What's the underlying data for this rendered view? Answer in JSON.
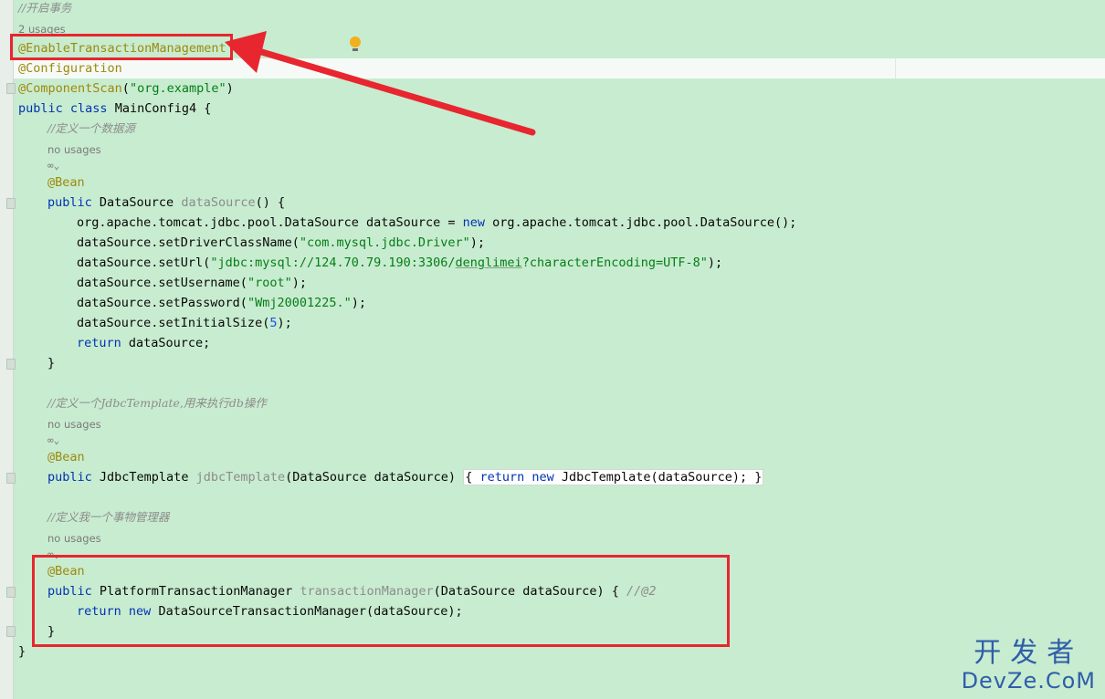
{
  "editor": {
    "comment_tx": "//开启事务",
    "usages_2": "2 usages",
    "ann_enable_tx": "@EnableTransactionManagement",
    "ann_configuration": "@Configuration",
    "ann_componentscan": "@ComponentScan",
    "componentscan_paren_open": "(",
    "componentscan_value": "\"org.example\"",
    "componentscan_paren_close": ")",
    "class_kw_public": "public",
    "class_kw_class": "class",
    "class_decl_rest": " MainConfig4 {",
    "comment_datasource": "//定义一个数据源",
    "no_usages": "no usages",
    "bean_gutter_icon": "∞⌄",
    "ann_bean": "@Bean",
    "ds_method_type": " DataSource ",
    "ds_method_name": "dataSource",
    "ds_method_tail": "() {",
    "ds_line1_a": "org.apache.tomcat.jdbc.pool.DataSource dataSource = ",
    "kw_new": "new",
    "ds_line1_b": " org.apache.tomcat.jdbc.pool.DataSource();",
    "ds_line2_a": "dataSource.setDriverClassName(",
    "ds_line2_str": "\"com.mysql.jdbc.Driver\"",
    "ds_line2_b": ");",
    "ds_line3_a": "dataSource.setUrl(",
    "ds_line3_str_a": "\"jdbc:mysql://124.70.79.190:3306/",
    "ds_line3_str_ul": "denglimei",
    "ds_line3_str_b": "?characterEncoding=UTF-8\"",
    "ds_line3_b": ");",
    "ds_line4_a": "dataSource.setUsername(",
    "ds_line4_str": "\"root\"",
    "ds_line4_b": ");",
    "ds_line5_a": "dataSource.setPassword(",
    "ds_line5_str": "\"Wmj20001225.\"",
    "ds_line5_b": ");",
    "ds_line6_a": "dataSource.setInitialSize(",
    "ds_line6_num": "5",
    "ds_line6_b": ");",
    "kw_return": "return",
    "ds_return_rest": " dataSource;",
    "close_brace": "}",
    "comment_jdbc": "//定义一个JdbcTemplate,用来执行db操作",
    "jt_type": " JdbcTemplate ",
    "jt_name": "jdbcTemplate",
    "jt_params": "(DataSource dataSource) ",
    "jt_open": "{",
    "jt_body_a": " JdbcTemplate(dataSource); ",
    "jt_close": "}",
    "comment_txm": "//定义我一个事物管理器",
    "tm_type": " PlatformTransactionManager ",
    "tm_name": "transactionManager",
    "tm_params": "(DataSource dataSource) { ",
    "tm_comment": "//@2",
    "tm_return_rest": " DataSourceTransactionManager(dataSource);",
    "class_close": "}"
  },
  "watermark": {
    "line1": "开发者",
    "line2": "DevZe.CoM"
  },
  "colors": {
    "background": "#c8ecd0",
    "highlight_box": "#e8262f",
    "keyword": "#0033b3",
    "annotation": "#9e880d",
    "string": "#067d17"
  }
}
